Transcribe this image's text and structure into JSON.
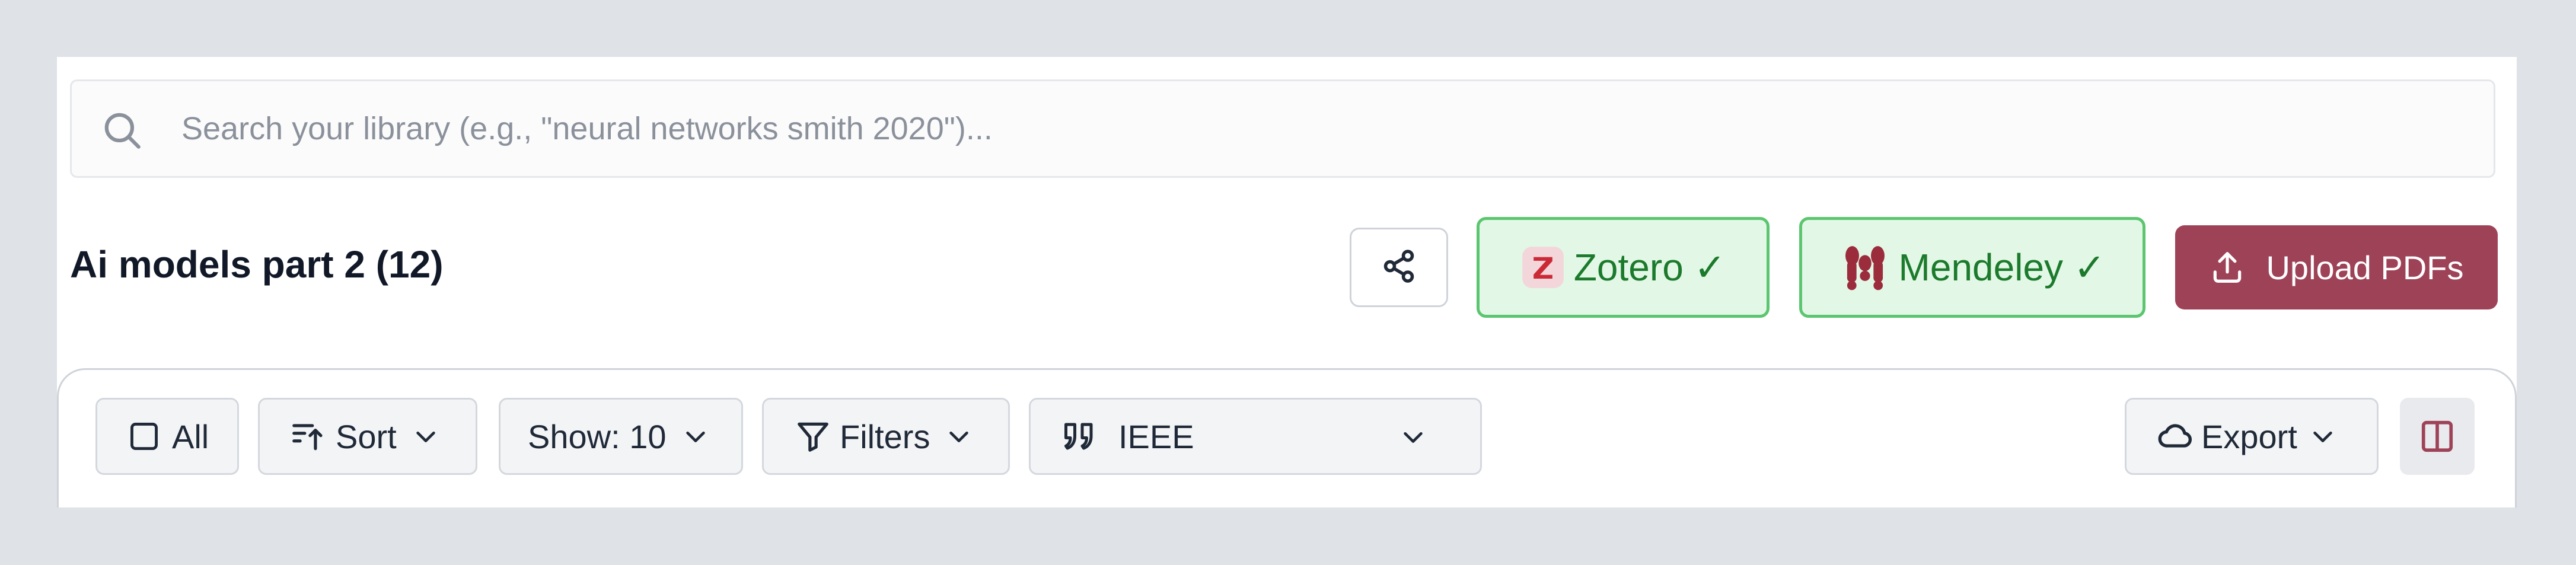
{
  "search": {
    "placeholder": "Search your library (e.g., \"neural networks smith 2020\")..."
  },
  "collection": {
    "title": "Ai models part 2 (12)"
  },
  "integrations": {
    "zotero_label": "Zotero ✓",
    "mendeley_label": "Mendeley ✓",
    "connected_color": "#1b7a2c"
  },
  "actions": {
    "upload_label": "Upload PDFs",
    "upload_color": "#9e4257"
  },
  "toolbar": {
    "all_label": "All",
    "sort_label": "Sort",
    "show_label": "Show: 10",
    "filters_label": "Filters",
    "citation_style": "IEEE",
    "export_label": "Export"
  },
  "icons": [
    "search-icon",
    "share-icon",
    "zotero-logo-icon",
    "mendeley-logo-icon",
    "upload-icon",
    "checkbox-icon",
    "sort-icon",
    "chevron-down-icon",
    "filter-icon",
    "quote-icon",
    "cloud-icon",
    "split-view-icon"
  ]
}
